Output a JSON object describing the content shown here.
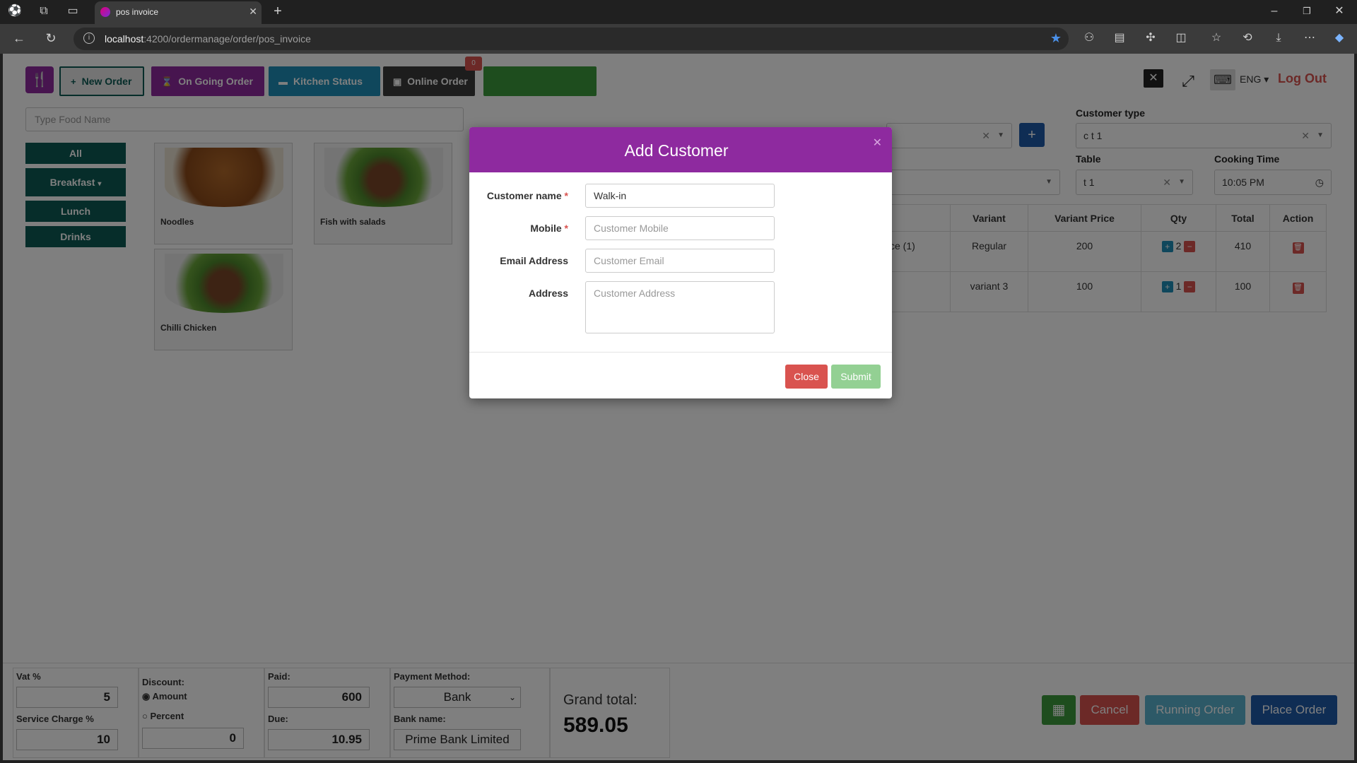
{
  "browser": {
    "tab_title": "pos invoice",
    "url_host": "localhost",
    "url_path": ":4200/ordermanage/order/pos_invoice"
  },
  "topnav": {
    "new_order": "New Order",
    "ongoing_order": "On Going Order",
    "kitchen_status": "Kitchen Status",
    "online_order": "Online Order",
    "online_badge": "0",
    "language": "ENG",
    "logout": "Log Out"
  },
  "search": {
    "placeholder": "Type Food Name"
  },
  "categories": [
    "All",
    "Breakfast",
    "Lunch",
    "Drinks"
  ],
  "foods": [
    "Noodles",
    "Fish with salads",
    "Chilli Chicken"
  ],
  "right_form": {
    "customer_type_label": "Customer type",
    "customer_type_value": "c t 1",
    "table_label": "Table",
    "table_value": "t 1",
    "cooking_time_label": "Cooking Time",
    "cooking_time_value": "10:05 PM"
  },
  "cart": {
    "headers": [
      "Variant",
      "Variant Price",
      "Qty",
      "Total",
      "Action"
    ],
    "rows": [
      {
        "item": "ce (1)",
        "variant": "Regular",
        "price": "200",
        "qty": "2",
        "total": "410"
      },
      {
        "item": "",
        "variant": "variant 3",
        "price": "100",
        "qty": "1",
        "total": "100"
      }
    ]
  },
  "bottom": {
    "vat_label": "Vat %",
    "vat_value": "5",
    "service_label": "Service Charge %",
    "service_value": "10",
    "discount_label": "Discount:",
    "amount_label": "Amount",
    "percent_label": "Percent",
    "discount_value": "0",
    "paid_label": "Paid:",
    "paid_value": "600",
    "due_label": "Due:",
    "due_value": "10.95",
    "payment_label": "Payment Method:",
    "payment_value": "Bank",
    "bank_label": "Bank name:",
    "bank_value": "Prime Bank Limited",
    "grand_label": "Grand total:",
    "grand_value": "589.05",
    "cancel": "Cancel",
    "running": "Running Order",
    "place": "Place Order"
  },
  "modal": {
    "title": "Add Customer",
    "name_label": "Customer name",
    "name_value": "Walk-in",
    "mobile_label": "Mobile",
    "mobile_placeholder": "Customer Mobile",
    "email_label": "Email Address",
    "email_placeholder": "Customer Email",
    "address_label": "Address",
    "address_placeholder": "Customer Address",
    "close": "Close",
    "submit": "Submit",
    "required_mark": "*"
  },
  "colors": {
    "brand_purple": "#8e2a9f",
    "teal": "#0c5b55",
    "kitchen_blue": "#1f8fb8",
    "online_dark": "#3a3a3a",
    "green": "#3c9a3c",
    "danger": "#d9534f",
    "submit_green": "#93d093",
    "place_blue": "#1e5aa8",
    "running_blue": "#5bb3cf"
  }
}
